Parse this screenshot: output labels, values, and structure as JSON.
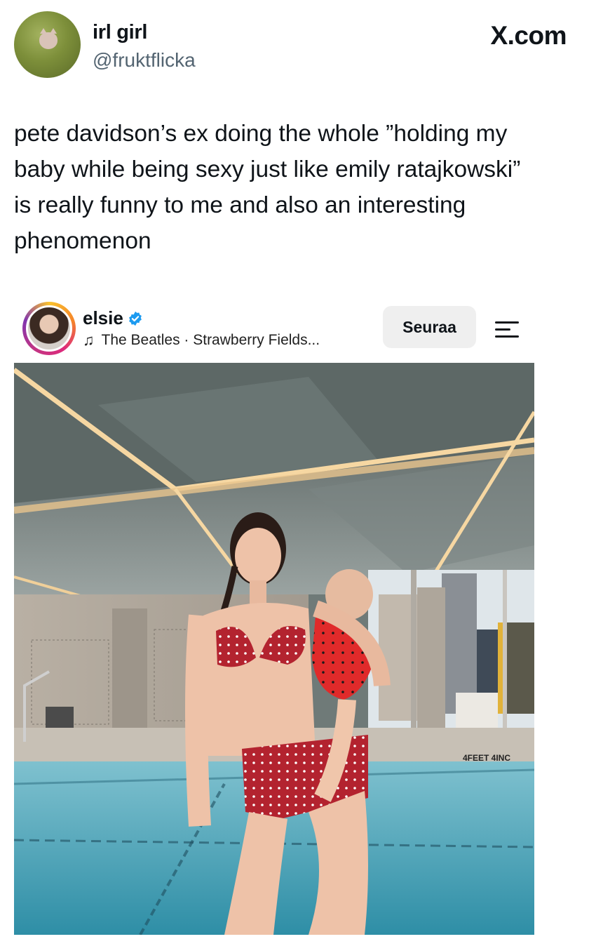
{
  "tweet": {
    "display_name": "irl girl",
    "handle": "@fruktflicka",
    "brand": "X.com",
    "text": "pete davidson’s ex doing the whole ”holding my\nbaby while being sexy just like emily ratajkowski”\nis really funny to me and also an interesting\nphenomenon"
  },
  "instagram": {
    "username": "elsie",
    "music_track": "The Beatles · Strawberry Fields...",
    "follow_label": "Seuraa",
    "icons": [
      "verified-badge-icon",
      "music-note-icon",
      "menu-icon"
    ],
    "colors": {
      "verified": "#1d9bf0",
      "follow_bg": "#efefef"
    }
  },
  "photo": {
    "pool_sign": "4FEET 4INC"
  }
}
